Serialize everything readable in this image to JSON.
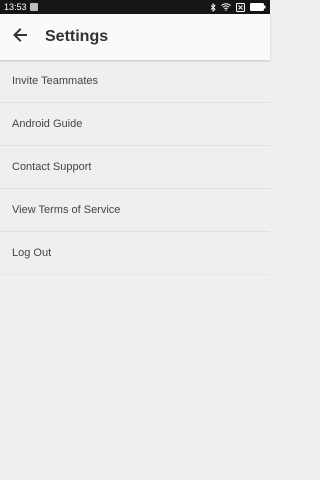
{
  "status_bar": {
    "time": "13:53",
    "icons": [
      "notification-icon",
      "bluetooth-icon",
      "wifi-icon",
      "sim-icon",
      "battery-icon"
    ]
  },
  "header": {
    "title": "Settings",
    "back_icon": "arrow-back-icon"
  },
  "menu": {
    "items": [
      {
        "label": "Invite Teammates"
      },
      {
        "label": "Android Guide"
      },
      {
        "label": "Contact Support"
      },
      {
        "label": "View Terms of Service"
      },
      {
        "label": "Log Out"
      }
    ]
  },
  "colors": {
    "status_bar": "#151515",
    "app_bar": "#fafafa",
    "background": "#efefef",
    "text": "#444444",
    "title": "#333333"
  }
}
